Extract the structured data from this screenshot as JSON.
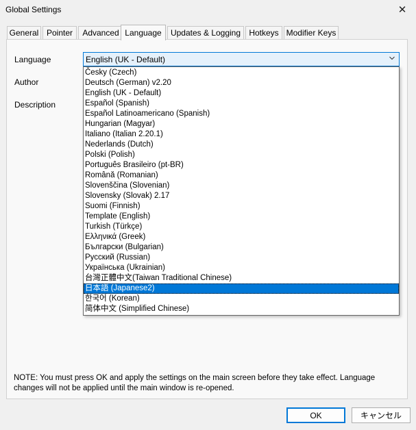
{
  "window": {
    "title": "Global Settings",
    "close_glyph": "✕"
  },
  "tabs": [
    {
      "label": "General"
    },
    {
      "label": "Pointer"
    },
    {
      "label": "Advanced"
    },
    {
      "label": "Language"
    },
    {
      "label": "Updates & Logging"
    },
    {
      "label": "Hotkeys"
    },
    {
      "label": "Modifier Keys"
    }
  ],
  "active_tab": "Language",
  "form": {
    "language_label": "Language",
    "author_label": "Author",
    "description_label": "Description",
    "language_value": "English (UK - Default)"
  },
  "dropdown": {
    "selected": "日本語 (Japanese2)",
    "options": [
      "Česky (Czech)",
      "Deutsch (German) v2.20",
      "English (UK - Default)",
      "Español (Spanish)",
      "Español Latinoamericano (Spanish)",
      "Hungarian (Magyar)",
      "Italiano (Italian 2.20.1)",
      "Nederlands (Dutch)",
      "Polski (Polish)",
      "Português Brasileiro (pt-BR)",
      "Română (Romanian)",
      "Slovenščina (Slovenian)",
      "Slovensky (Slovak) 2.17",
      "Suomi (Finnish)",
      "Template (English)",
      "Turkish (Türkçe)",
      "Ελληνικά (Greek)",
      "Български (Bulgarian)",
      "Русский (Russian)",
      "Українська (Ukrainian)",
      "台灣正體中文(Taiwan Traditional Chinese)",
      "日本語 (Japanese2)",
      "한국어 (Korean)",
      "简体中文 (Simplified Chinese)"
    ]
  },
  "note": "NOTE: You must press OK and apply the settings on the main screen before they take effect. Language changes will not be applied until the main window is re-opened.",
  "buttons": {
    "ok": "OK",
    "cancel": "キャンセル"
  },
  "colors": {
    "accent": "#0078d7",
    "select_bg": "#e5f1fb",
    "window_bg": "#f0f0f0"
  },
  "icons": {
    "chevron": "chevron-down-icon",
    "close": "close-icon"
  }
}
